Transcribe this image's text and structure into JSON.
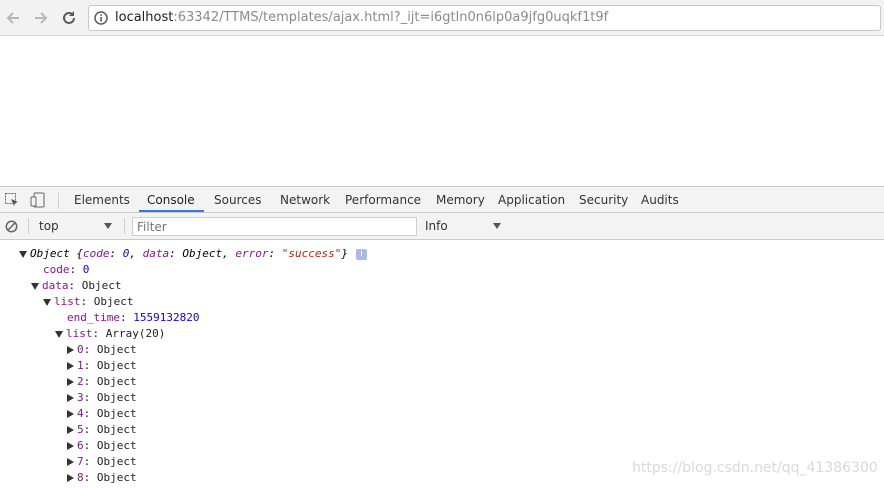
{
  "browser": {
    "url_host": "localhost",
    "url_rest": ":63342/TTMS/templates/ajax.html?_ijt=i6gtln0n6lp0a9jfg0uqkf1t9f"
  },
  "devtools": {
    "tabs": [
      {
        "label": "Elements"
      },
      {
        "label": "Console",
        "active": true
      },
      {
        "label": "Sources"
      },
      {
        "label": "Network"
      },
      {
        "label": "Performance"
      },
      {
        "label": "Memory"
      },
      {
        "label": "Application"
      },
      {
        "label": "Security"
      },
      {
        "label": "Audits"
      }
    ],
    "context": "top",
    "filter_placeholder": "Filter",
    "level": "Info",
    "accent_color": "#3879d9"
  },
  "console": {
    "root": {
      "type": "Object",
      "preview_keys": [
        "code",
        "data",
        "error"
      ],
      "preview_vals": [
        "0",
        "Object",
        "\"success\""
      ],
      "info_badge": "i"
    },
    "code": {
      "key": "code",
      "value": "0"
    },
    "data": {
      "key": "data",
      "value": "Object"
    },
    "list": {
      "key": "list",
      "value": "Object"
    },
    "end_time": {
      "key": "end_time",
      "value": "1559132820"
    },
    "inner_list": {
      "key": "list",
      "value": "Array(20)"
    },
    "items": [
      {
        "key": "0",
        "value": "Object"
      },
      {
        "key": "1",
        "value": "Object"
      },
      {
        "key": "2",
        "value": "Object"
      },
      {
        "key": "3",
        "value": "Object"
      },
      {
        "key": "4",
        "value": "Object"
      },
      {
        "key": "5",
        "value": "Object"
      },
      {
        "key": "6",
        "value": "Object"
      },
      {
        "key": "7",
        "value": "Object"
      },
      {
        "key": "8",
        "value": "Object"
      }
    ]
  },
  "watermark": "https://blog.csdn.net/qq_41386300"
}
